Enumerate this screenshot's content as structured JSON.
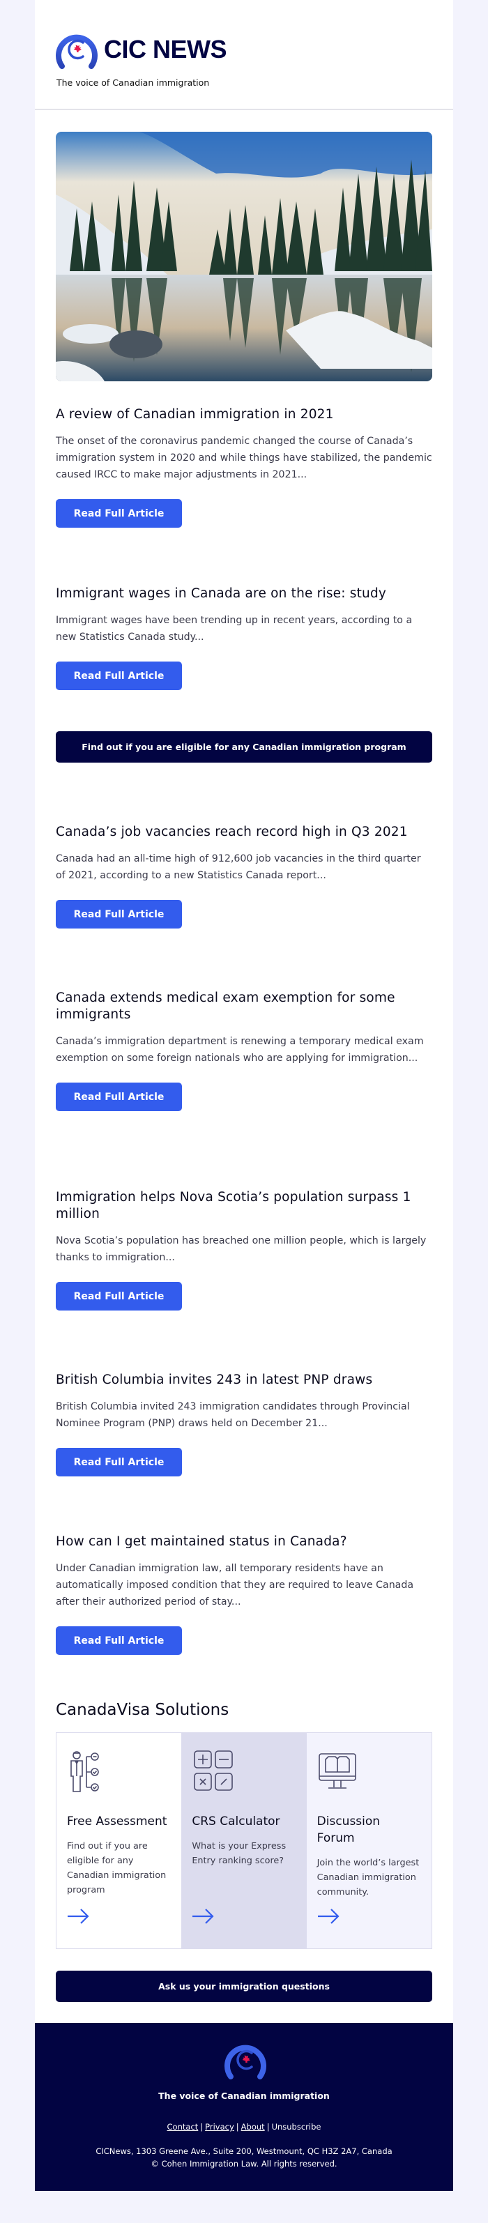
{
  "header": {
    "brand": "CIC NEWS",
    "tagline": "The voice of Canadian immigration"
  },
  "hero": {
    "alt": "Snowy forest reflected in a calm lake"
  },
  "articles": [
    {
      "title": "A review of Canadian immigration in 2021",
      "summary": "The onset of the coronavirus pandemic changed the course of Canada’s immigration system in 2020 and while things have stabilized, the pandemic caused IRCC to make major adjustments in 2021...",
      "button": "Read Full Article"
    },
    {
      "title": "Immigrant wages in Canada are on the rise: study",
      "summary": "Immigrant wages have been trending up in recent years, according to a new Statistics Canada study...",
      "button": "Read Full Article"
    },
    {
      "title": "Canada’s job vacancies reach record high in Q3 2021",
      "summary": "Canada had an all-time high of 912,600 job vacancies in the third quarter of 2021, according to a new Statistics Canada report...",
      "button": "Read Full Article"
    },
    {
      "title": "Canada extends medical exam exemption for some immigrants",
      "summary": "Canada’s immigration department is renewing a temporary medical exam exemption on some foreign nationals who are applying for immigration...",
      "button": "Read Full Article"
    },
    {
      "title": "Immigration helps Nova Scotia’s population surpass 1 million",
      "summary": "Nova Scotia’s population has breached one million people, which is largely thanks to immigration...",
      "button": "Read Full Article"
    },
    {
      "title": "British Columbia invites 243 in latest PNP draws",
      "summary": "British Columbia invited 243 immigration candidates through Provincial Nominee Program (PNP) draws held on December 21...",
      "button": "Read Full Article"
    },
    {
      "title": "How can I get maintained status in Canada?",
      "summary": "Under Canadian immigration law, all temporary residents have an automatically imposed condition that they are required to leave Canada after their authorized period of stay...",
      "button": "Read Full Article"
    }
  ],
  "eligibility_cta": "Find out if you are eligible for any Canadian immigration program",
  "solutions": {
    "title": "CanadaVisa Solutions",
    "items": [
      {
        "icon": "assessment-person-checklist-icon",
        "title": "Free Assessment",
        "text": "Find out if you are eligible for any Canadian immigration program"
      },
      {
        "icon": "calculator-icon",
        "title": "CRS Calculator",
        "text": "What is your Express Entry ranking score?"
      },
      {
        "icon": "forum-book-monitor-icon",
        "title": "Discussion Forum",
        "text": "Join the world’s largest Canadian immigration community."
      }
    ]
  },
  "ask_cta": "Ask us your immigration questions",
  "footer": {
    "tagline": "The voice of Canadian immigration",
    "links": [
      "Contact",
      "Privacy",
      "About"
    ],
    "unsubscribe": "Unsubscribe",
    "address": "CICNews, 1303 Greene Ave., Suite 200, Westmount, QC H3Z 2A7, Canada",
    "copyright": "© Cohen Immigration Law. All rights reserved."
  },
  "colors": {
    "brand_navy": "#020442",
    "button_blue": "#335ced",
    "maple_red": "#e8194d",
    "page_bg": "#f3f3fd"
  }
}
